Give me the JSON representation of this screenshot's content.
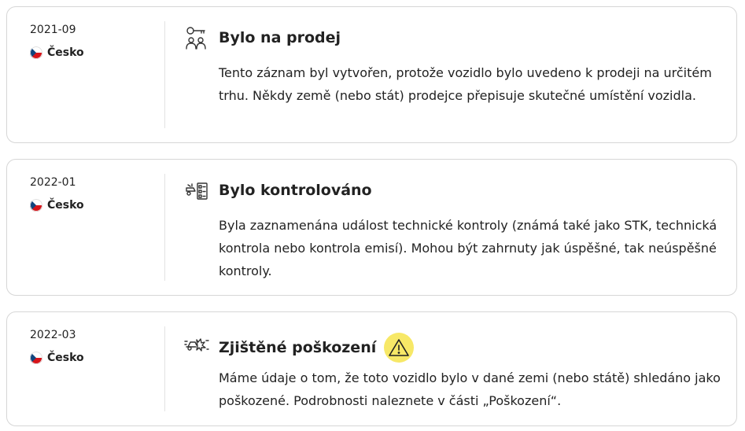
{
  "events": [
    {
      "date": "2021-09",
      "country": "Česko",
      "icon": "for-sale-icon",
      "title": "Bylo na prodej",
      "description": "Tento záznam byl vytvořen, protože vozidlo bylo uvedeno k prodeji na určitém trhu. Někdy země (nebo stát) prodejce přepisuje skutečné umístění vozidla."
    },
    {
      "date": "2022-01",
      "country": "Česko",
      "icon": "inspection-icon",
      "title": "Bylo kontrolováno",
      "description": "Byla zaznamenána událost technické kontroly (známá také jako STK, technická kontrola nebo kontrola emisí). Mohou být zahrnuty jak úspěšné, tak neúspěšné kontroly."
    },
    {
      "date": "2022-03",
      "country": "Česko",
      "icon": "damage-icon",
      "title": "Zjištěné poškození",
      "warning": true,
      "description": "Máme údaje o tom, že toto vozidlo bylo v dané zemi (nebo státě) shledáno jako poškozené. Podrobnosti naleznete v části „Poškození“."
    }
  ],
  "colors": {
    "warning_bg": "#f7e867",
    "border": "#d6d6d6",
    "flag_white": "#ffffff",
    "flag_red": "#d7141a",
    "flag_blue": "#11457e"
  }
}
